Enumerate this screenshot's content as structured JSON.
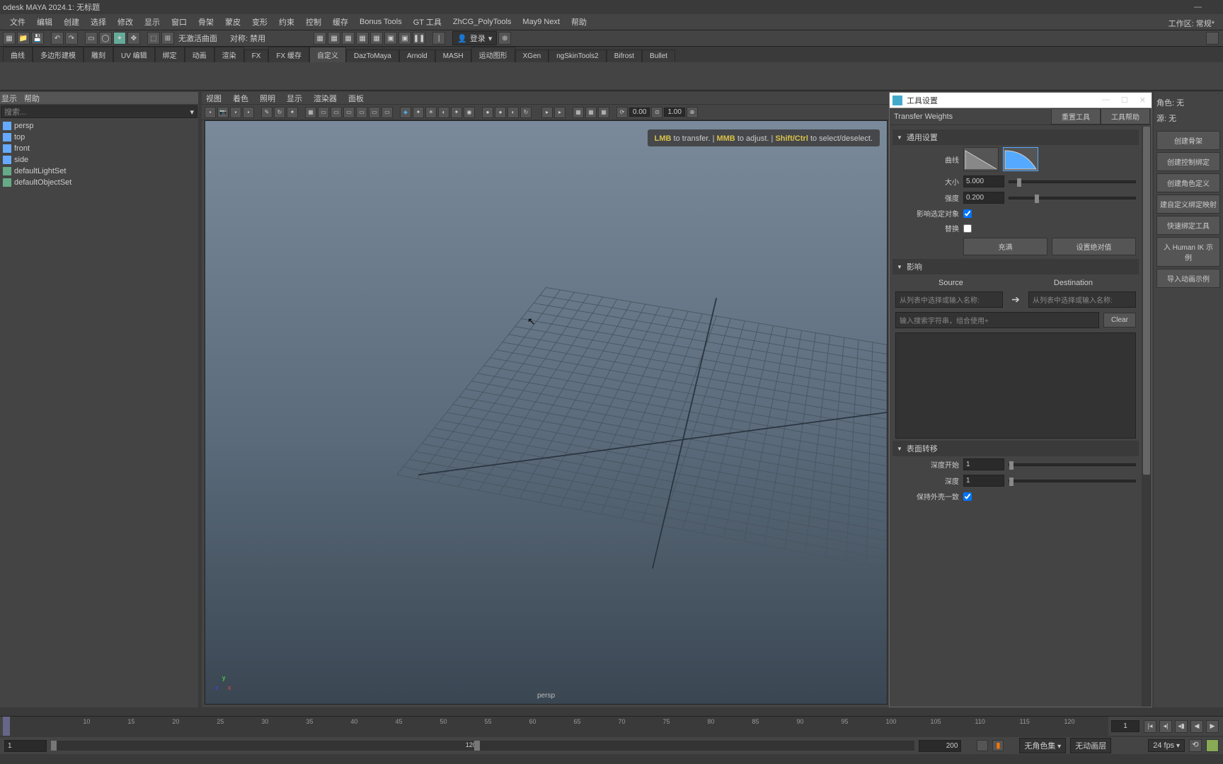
{
  "title": "odesk MAYA 2024.1: 无标题",
  "menus": [
    "文件",
    "编辑",
    "创建",
    "选择",
    "修改",
    "显示",
    "窗口",
    "骨架",
    "蒙皮",
    "变形",
    "约束",
    "控制",
    "缓存",
    "Bonus Tools",
    "GT 工具",
    "ZhCG_PolyTools",
    "May9 Next",
    "帮助"
  ],
  "workspace_label": "工作区: 常规*",
  "shelf": {
    "field1": "无激活曲面",
    "sym_label": "对称: 禁用",
    "login": "登录",
    "num1": "0.00",
    "num2": "1.00"
  },
  "tabs": [
    "曲线",
    "多边形建模",
    "雕刻",
    "UV 编辑",
    "绑定",
    "动画",
    "渲染",
    "FX",
    "FX 缓存",
    "自定义",
    "DazToMaya",
    "Arnold",
    "MASH",
    "运动图形",
    "XGen",
    "ngSkinTools2",
    "Bifrost",
    "Bullet"
  ],
  "active_tab": "自定义",
  "outliner": {
    "menu": [
      "显示",
      "帮助"
    ],
    "search_placeholder": "搜索...",
    "items": [
      "persp",
      "top",
      "front",
      "side",
      "defaultLightSet",
      "defaultObjectSet"
    ]
  },
  "vp": {
    "menus": [
      "视图",
      "着色",
      "照明",
      "显示",
      "渲染器",
      "面板"
    ],
    "num1": "0.00",
    "num2": "1.00",
    "hint_lmb": "LMB",
    "hint_t1": " to transfer. | ",
    "hint_mmb": "MMB",
    "hint_t2": " to adjust. | ",
    "hint_sc": "Shift/Ctrl",
    "hint_t3": " to select/deselect.",
    "cam": "persp"
  },
  "tool": {
    "win_title": "工具设置",
    "mode": "Transfer Weights",
    "btn_reset": "重置工具",
    "btn_help": "工具帮助",
    "sec_general": "通用设置",
    "lbl_curve": "曲线",
    "lbl_size": "大小",
    "val_size": "5.000",
    "lbl_strength": "强度",
    "val_strength": "0.200",
    "lbl_affect": "影响选定对象",
    "lbl_replace": "替换",
    "btn_flood": "充满",
    "btn_abs": "设置绝对值",
    "sec_influence": "影响",
    "col_src": "Source",
    "col_dst": "Destination",
    "ph_src": "从列表中选择或输入名称:",
    "ph_dst": "从列表中选择或输入名称:",
    "ph_filter": "输入搜索字符串，组合使用+",
    "btn_clear": "Clear",
    "sec_surface": "表面转移",
    "lbl_depth_start": "深度开始",
    "val_depth_start": "1",
    "lbl_depth": "深度",
    "val_depth": "1",
    "lbl_preserve": "保持外壳一致"
  },
  "right": {
    "role_label": "角色: 无",
    "src_label": "源: 无",
    "btns": [
      "创建骨架",
      "创建控制绑定",
      "创建角色定义",
      "建自定义绑定映射",
      "快速绑定工具",
      "入 Human IK 示例",
      "导入动画示例"
    ]
  },
  "timeline": {
    "ticks": [
      1,
      10,
      15,
      20,
      25,
      30,
      35,
      40,
      45,
      50,
      55,
      60,
      65,
      70,
      75,
      80,
      85,
      90,
      95,
      100,
      105,
      110,
      115,
      120
    ],
    "current": "1",
    "range_start": "1",
    "range_mid": "120",
    "range_end": "200",
    "charset": "无角色集",
    "layer": "无动画层",
    "fps": "24 fps"
  }
}
